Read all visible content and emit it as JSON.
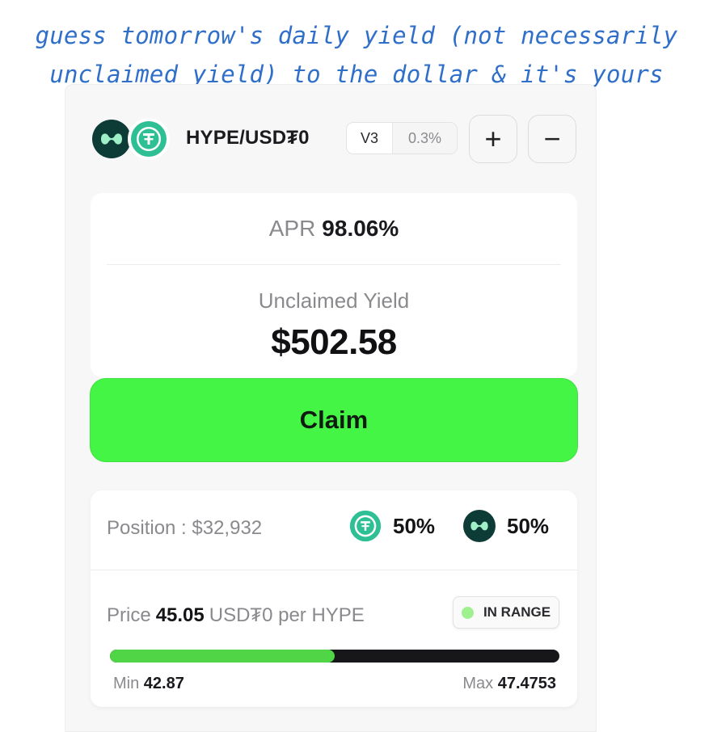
{
  "caption": {
    "line1": "guess tomorrow's daily yield (not necessarily",
    "line2": "unclaimed yield) to the dollar & it's yours"
  },
  "pool": {
    "pair": "HYPE/USD₮0",
    "version": "V3",
    "fee": "0.3%",
    "icons": [
      "hype-token-icon",
      "usdt0-token-icon"
    ],
    "colors": {
      "hype_bg": "#0d3b36",
      "usdt_green": "#2fbf95"
    }
  },
  "actions": {
    "add_label": "+",
    "remove_label": "−"
  },
  "yield": {
    "apr_label": "APR",
    "apr_value": "98.06%",
    "unclaimed_label": "Unclaimed Yield",
    "unclaimed_value": "$502.58"
  },
  "claim": {
    "label": "Claim",
    "color": "#44f545"
  },
  "position": {
    "label": "Position : $32,932",
    "usdt_share": "50%",
    "hype_share": "50%"
  },
  "price": {
    "label": "Price",
    "value": "45.05",
    "unit": "USD₮0 per HYPE",
    "status": "IN RANGE",
    "min_label": "Min",
    "min_value": "42.87",
    "max_label": "Max",
    "max_value": "47.4753",
    "range_fraction": 0.5,
    "fill_color": "#4fd545"
  }
}
